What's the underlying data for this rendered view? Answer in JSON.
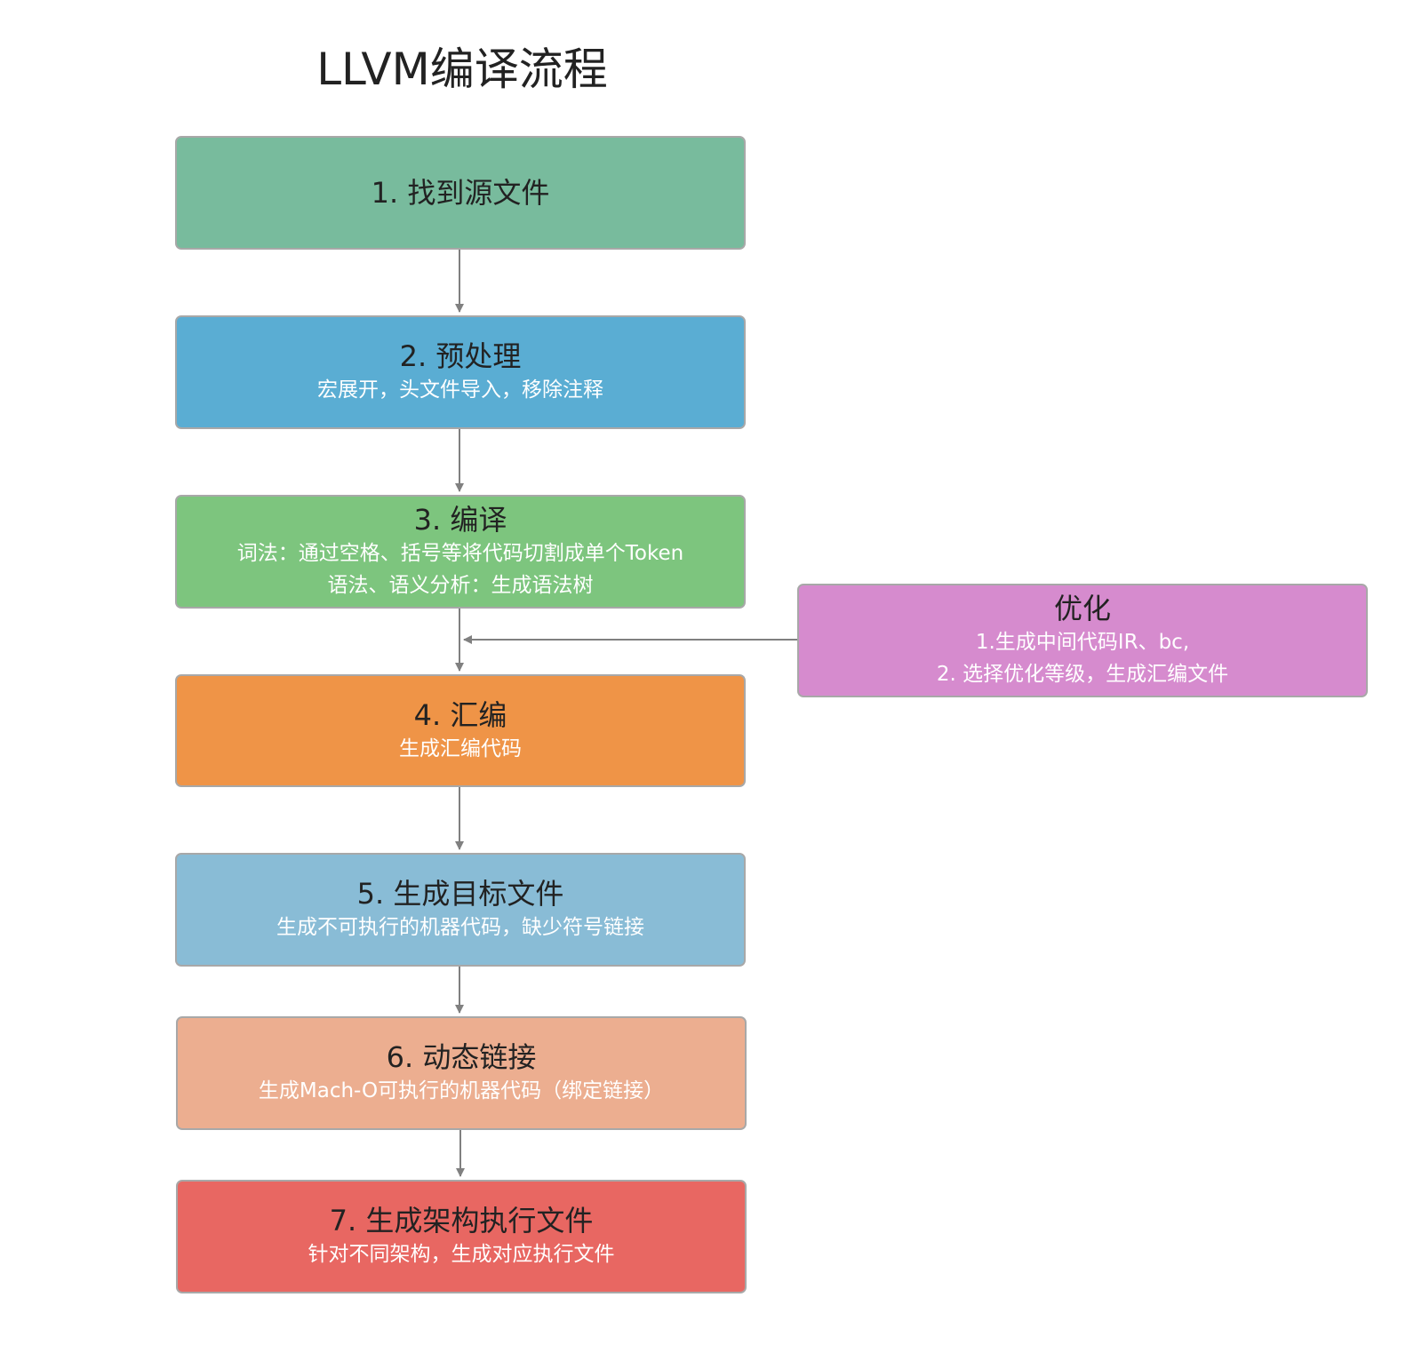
{
  "title": "LLVM编译流程",
  "colors": {
    "step1": "#78bb9d",
    "step2": "#5aadd3",
    "step3": "#7dc57e",
    "step4": "#ef9447",
    "step5": "#89bcd6",
    "step6": "#ecae90",
    "step7": "#e86762",
    "optimize": "#d68bce",
    "connector": "#808080"
  },
  "steps": [
    {
      "title": "1. 找到源文件",
      "lines": []
    },
    {
      "title": "2. 预处理",
      "lines": [
        "宏展开，头文件导入，移除注释"
      ]
    },
    {
      "title": "3. 编译",
      "lines": [
        "词法：通过空格、括号等将代码切割成单个Token",
        "语法、语义分析：生成语法树"
      ]
    },
    {
      "title": "4. 汇编",
      "lines": [
        "生成汇编代码"
      ]
    },
    {
      "title": "5. 生成目标文件",
      "lines": [
        "生成不可执行的机器代码，缺少符号链接"
      ]
    },
    {
      "title": "6. 动态链接",
      "lines": [
        "生成Mach-O可执行的机器代码（绑定链接）"
      ]
    },
    {
      "title": "7. 生成架构执行文件",
      "lines": [
        "针对不同架构，生成对应执行文件"
      ]
    }
  ],
  "optimize": {
    "title": "优化",
    "lines": [
      "1.生成中间代码IR、bc,",
      "2. 选择优化等级，生成汇编文件"
    ]
  }
}
